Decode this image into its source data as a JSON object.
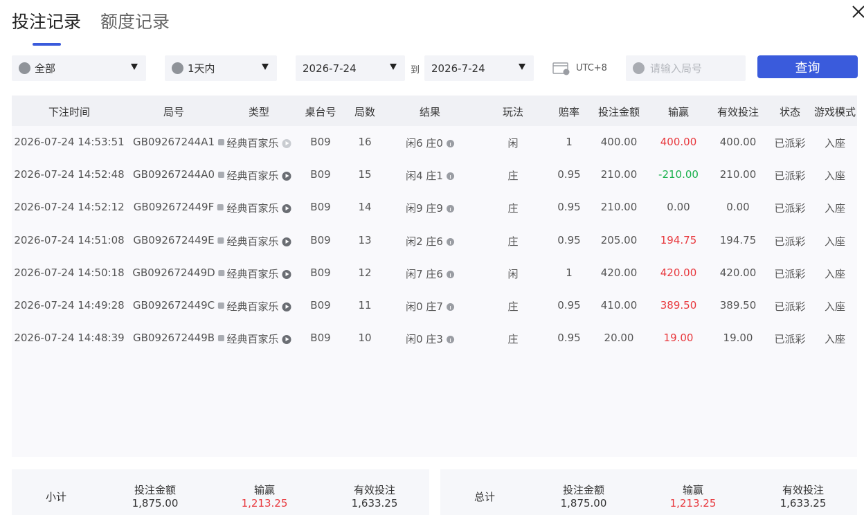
{
  "tabs": [
    "投注记录",
    "额度记录"
  ],
  "filters": {
    "type": "全部",
    "range": "1天内",
    "date_from": "2026-7-24",
    "to_label": "到",
    "date_to": "2026-7-24",
    "tz": "UTC+8",
    "search_placeholder": "请输入局号",
    "query_label": "查询"
  },
  "table": {
    "headers": [
      "下注时间",
      "局号",
      "类型",
      "桌台号",
      "局数",
      "结果",
      "玩法",
      "赔率",
      "投注金额",
      "输赢",
      "有效投注",
      "状态",
      "游戏模式"
    ],
    "rows": [
      {
        "time": "2026-07-24 14:53:51",
        "id": "GB09267244A1",
        "type": "经典百家乐",
        "table": "B09",
        "round": "16",
        "result": "闲6 庄0",
        "play": "闲",
        "odds": "1",
        "bet": "400.00",
        "win": "400.00",
        "valid": "400.00",
        "status": "已派彩",
        "mode": "入座",
        "tone": "pos"
      },
      {
        "time": "2026-07-24 14:52:48",
        "id": "GB09267244A0",
        "type": "经典百家乐",
        "table": "B09",
        "round": "15",
        "result": "闲4 庄1",
        "play": "庄",
        "odds": "0.95",
        "bet": "210.00",
        "win": "-210.00",
        "valid": "210.00",
        "status": "已派彩",
        "mode": "入座",
        "tone": "neg"
      },
      {
        "time": "2026-07-24 14:52:12",
        "id": "GB092672449F",
        "type": "经典百家乐",
        "table": "B09",
        "round": "14",
        "result": "闲9 庄9",
        "play": "庄",
        "odds": "0.95",
        "bet": "210.00",
        "win": "0.00",
        "valid": "0.00",
        "status": "已派彩",
        "mode": "入座",
        "tone": "zero"
      },
      {
        "time": "2026-07-24 14:51:08",
        "id": "GB092672449E",
        "type": "经典百家乐",
        "table": "B09",
        "round": "13",
        "result": "闲2 庄6",
        "play": "庄",
        "odds": "0.95",
        "bet": "205.00",
        "win": "194.75",
        "valid": "194.75",
        "status": "已派彩",
        "mode": "入座",
        "tone": "pos"
      },
      {
        "time": "2026-07-24 14:50:18",
        "id": "GB092672449D",
        "type": "经典百家乐",
        "table": "B09",
        "round": "12",
        "result": "闲7 庄6",
        "play": "闲",
        "odds": "1",
        "bet": "420.00",
        "win": "420.00",
        "valid": "420.00",
        "status": "已派彩",
        "mode": "入座",
        "tone": "pos"
      },
      {
        "time": "2026-07-24 14:49:28",
        "id": "GB092672449C",
        "type": "经典百家乐",
        "table": "B09",
        "round": "11",
        "result": "闲0 庄7",
        "play": "庄",
        "odds": "0.95",
        "bet": "410.00",
        "win": "389.50",
        "valid": "389.50",
        "status": "已派彩",
        "mode": "入座",
        "tone": "pos"
      },
      {
        "time": "2026-07-24 14:48:39",
        "id": "GB092672449B",
        "type": "经典百家乐",
        "table": "B09",
        "round": "10",
        "result": "闲0 庄3",
        "play": "庄",
        "odds": "0.95",
        "bet": "20.00",
        "win": "19.00",
        "valid": "19.00",
        "status": "已派彩",
        "mode": "入座",
        "tone": "pos"
      }
    ]
  },
  "subtotal": {
    "label": "小计",
    "bet_label": "投注金额",
    "bet": "1,875.00",
    "win_label": "输赢",
    "win": "1,213.25",
    "valid_label": "有效投注",
    "valid": "1,633.25"
  },
  "total": {
    "label": "总计",
    "bet_label": "投注金额",
    "bet": "1,875.00",
    "win_label": "输赢",
    "win": "1,213.25",
    "valid_label": "有效投注",
    "valid": "1,633.25"
  },
  "colors": {
    "accent": "#3a5bdc",
    "positive": "#e8383d",
    "negative": "#18b04b"
  },
  "icons": {
    "close": "close-icon",
    "type": "spade-icon",
    "range": "clock-icon",
    "calendar": "calendar-icon",
    "search": "chat-icon",
    "copy": "copy-icon",
    "video": "play-icon",
    "info": "info-icon"
  }
}
